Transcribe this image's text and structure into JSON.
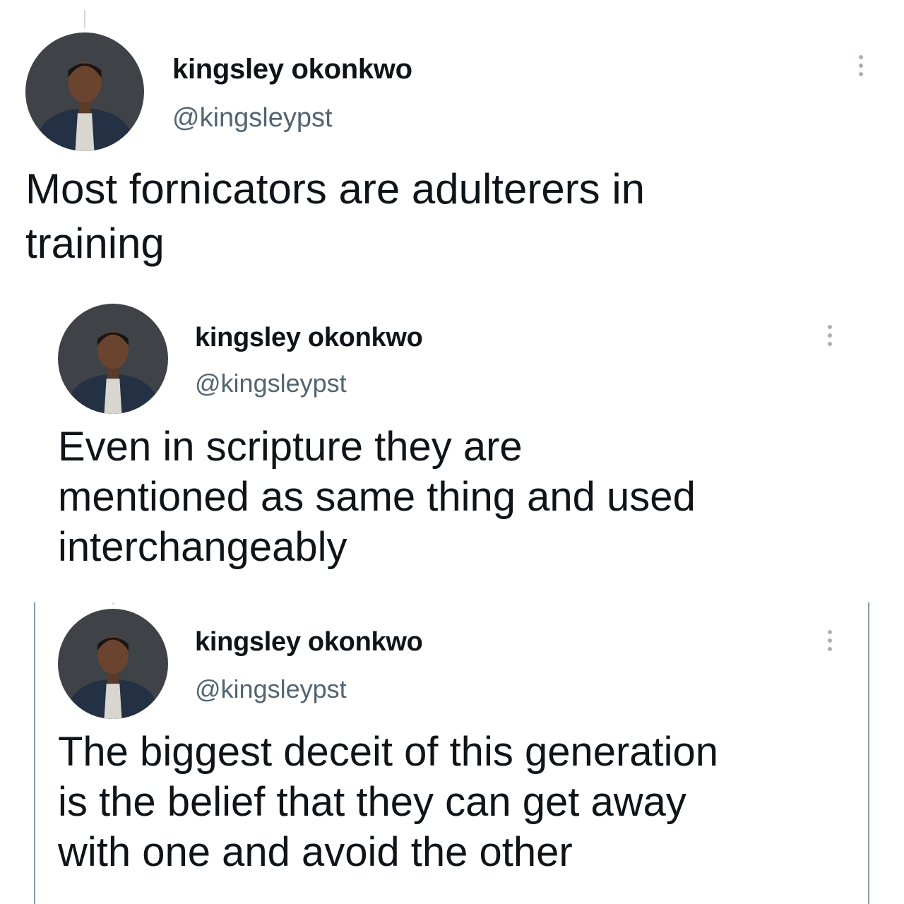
{
  "tweets": [
    {
      "author_name": "kingsley okonkwo",
      "author_handle": "@kingsleypst",
      "text_lines": [
        "Most fornicators are adulterers in",
        "training"
      ],
      "avatar_icon": "profile-photo",
      "menu_icon": "more-vertical-icon"
    },
    {
      "author_name": "kingsley okonkwo",
      "author_handle": "@kingsleypst",
      "text_lines": [
        "Even in scripture they are",
        "mentioned as same thing and used",
        "interchangeably"
      ],
      "avatar_icon": "profile-photo",
      "menu_icon": "more-vertical-icon"
    },
    {
      "author_name": "kingsley okonkwo",
      "author_handle": "@kingsleypst",
      "text_lines": [
        "The biggest deceit of this generation",
        "is the belief that they can get away",
        "with one and avoid the other"
      ],
      "avatar_icon": "profile-photo",
      "menu_icon": "more-vertical-icon"
    }
  ],
  "colors": {
    "text": "#0f1419",
    "handle": "#536471",
    "menu_dots": "#a7b1b8",
    "quote_border": "#8a98a8"
  }
}
